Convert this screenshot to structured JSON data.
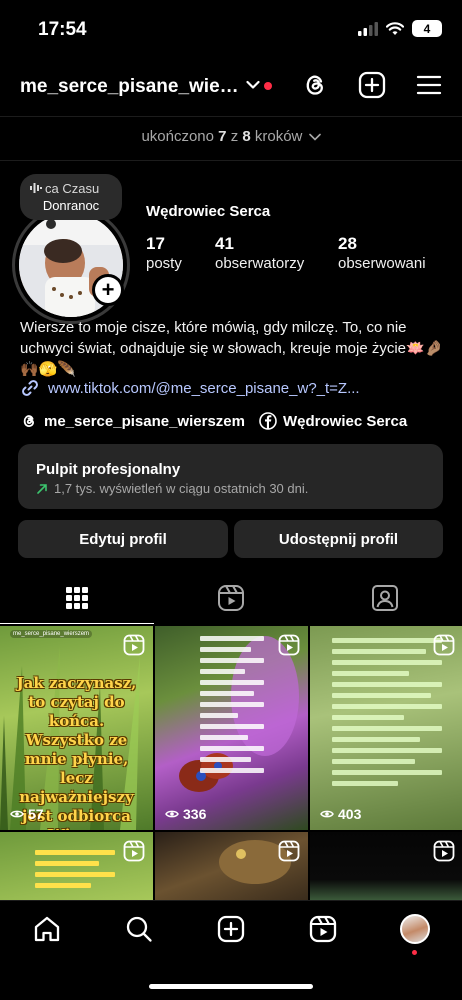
{
  "status_bar": {
    "time": "17:54",
    "battery": "4"
  },
  "header": {
    "username": "me_serce_pisane_wiersz..."
  },
  "progress": {
    "prefix": "ukończono",
    "done": "7",
    "middle": "z",
    "total": "8",
    "suffix": "kroków"
  },
  "note": {
    "line1": "ca Czasu",
    "line2": "Donranoc"
  },
  "profile": {
    "display_name": "Wędrowiec Serca",
    "stats": [
      {
        "value": "17",
        "label": "posty"
      },
      {
        "value": "41",
        "label": "obserwatorzy"
      },
      {
        "value": "28",
        "label": "obserwowani"
      }
    ],
    "bio": "Wiersze to moje cisze, które mówią, gdy milczę. To, co nie uchwyci świat, odnajduje się w słowach, kreuje moje życie🪷🤌🏽🙌🏾🫣🪶",
    "link": "www.tiktok.com/@me_serce_pisane_w?_t=Z...",
    "threads_name": "me_serce_pisane_wierszem",
    "facebook_name": "Wędrowiec Serca"
  },
  "dashboard": {
    "title": "Pulpit profesjonalny",
    "subtitle": "1,7 tys. wyświetleń w ciągu ostatnich 30 dni."
  },
  "buttons": {
    "edit": "Edytuj profil",
    "share": "Udostępnij profil"
  },
  "grid": {
    "tiles": [
      {
        "views": "57",
        "caption": "Jak zaczynasz, to czytaj do końca. Wszystko ze mnie płynie, lecz najważniejszy jest odbiorca Wiersz \"Buzia\"",
        "tag": "me_serce_pisane_wierszem"
      },
      {
        "views": "336"
      },
      {
        "views": "403"
      }
    ]
  },
  "colors": {
    "background": "#000000",
    "surface": "#262626",
    "link": "#b8c8ff",
    "accent_red": "#ff2d46",
    "growth_green": "#3cc46e"
  }
}
